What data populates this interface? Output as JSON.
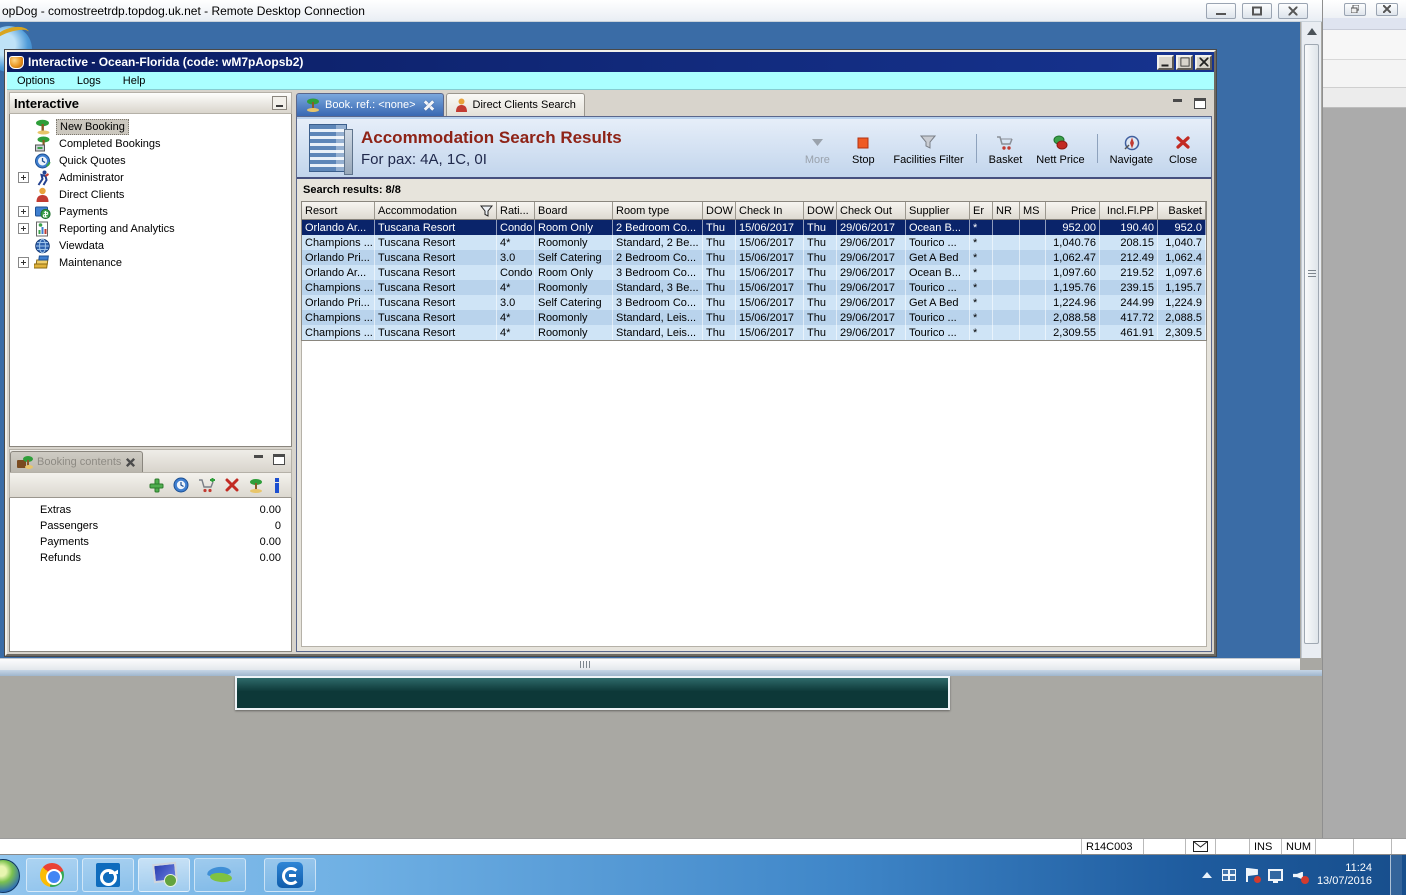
{
  "rdp": {
    "title": "opDog - comostreetrdp.topdog.uk.net - Remote Desktop Connection"
  },
  "app": {
    "title": "Interactive - Ocean-Florida (code: wM7pAopsb2)",
    "menu": {
      "options": "Options",
      "logs": "Logs",
      "help": "Help"
    }
  },
  "sidebar": {
    "title": "Interactive",
    "items": [
      {
        "label": "New Booking",
        "icon": "palm-tree-icon",
        "selected": true,
        "expandable": false
      },
      {
        "label": "Completed Bookings",
        "icon": "palm-money-icon",
        "expandable": false
      },
      {
        "label": "Quick Quotes",
        "icon": "clock-globe-icon",
        "expandable": false
      },
      {
        "label": "Administrator",
        "icon": "runner-icon",
        "expandable": true
      },
      {
        "label": "Direct Clients",
        "icon": "person-icon",
        "expandable": false
      },
      {
        "label": "Payments",
        "icon": "money-card-icon",
        "expandable": true
      },
      {
        "label": "Reporting and Analytics",
        "icon": "report-chart-icon",
        "expandable": true
      },
      {
        "label": "Viewdata",
        "icon": "globe-icon",
        "expandable": false
      },
      {
        "label": "Maintenance",
        "icon": "tools-icon",
        "expandable": true
      }
    ]
  },
  "tabs": {
    "booking": "Book. ref.: <none>",
    "direct_clients": "Direct Clients Search"
  },
  "results": {
    "title": "Accommodation Search Results",
    "subtitle": "For pax: 4A, 1C, 0I",
    "summary": "Search results: 8/8",
    "columns": [
      "Resort",
      "Accommodation",
      "Rati...",
      "Board",
      "Room type",
      "DOW",
      "Check In",
      "DOW",
      "Check Out",
      "Supplier",
      "Er",
      "NR",
      "MS",
      "Price",
      "Incl.Fl.PP",
      "Basket"
    ],
    "rows": [
      [
        "Orlando Ar...",
        "Tuscana Resort",
        "Condo",
        "Room Only",
        "2 Bedroom Co...",
        "Thu",
        "15/06/2017",
        "Thu",
        "29/06/2017",
        "Ocean B...",
        "*",
        "",
        "",
        "952.00",
        "190.40",
        "952.0"
      ],
      [
        "Champions ...",
        "Tuscana Resort",
        "4*",
        "Roomonly",
        "Standard, 2 Be...",
        "Thu",
        "15/06/2017",
        "Thu",
        "29/06/2017",
        "Tourico ...",
        "*",
        "",
        "",
        "1,040.76",
        "208.15",
        "1,040.7"
      ],
      [
        "Orlando Pri...",
        "Tuscana Resort",
        "3.0",
        "Self Catering",
        "2 Bedroom Co...",
        "Thu",
        "15/06/2017",
        "Thu",
        "29/06/2017",
        "Get A Bed",
        "*",
        "",
        "",
        "1,062.47",
        "212.49",
        "1,062.4"
      ],
      [
        "Orlando Ar...",
        "Tuscana Resort",
        "Condo",
        "Room Only",
        "3 Bedroom Co...",
        "Thu",
        "15/06/2017",
        "Thu",
        "29/06/2017",
        "Ocean B...",
        "*",
        "",
        "",
        "1,097.60",
        "219.52",
        "1,097.6"
      ],
      [
        "Champions ...",
        "Tuscana Resort",
        "4*",
        "Roomonly",
        "Standard, 3 Be...",
        "Thu",
        "15/06/2017",
        "Thu",
        "29/06/2017",
        "Tourico ...",
        "*",
        "",
        "",
        "1,195.76",
        "239.15",
        "1,195.7"
      ],
      [
        "Orlando Pri...",
        "Tuscana Resort",
        "3.0",
        "Self Catering",
        "3 Bedroom Co...",
        "Thu",
        "15/06/2017",
        "Thu",
        "29/06/2017",
        "Get A Bed",
        "*",
        "",
        "",
        "1,224.96",
        "244.99",
        "1,224.9"
      ],
      [
        "Champions ...",
        "Tuscana Resort",
        "4*",
        "Roomonly",
        "Standard, Leis...",
        "Thu",
        "15/06/2017",
        "Thu",
        "29/06/2017",
        "Tourico ...",
        "*",
        "",
        "",
        "2,088.58",
        "417.72",
        "2,088.5"
      ],
      [
        "Champions ...",
        "Tuscana Resort",
        "4*",
        "Roomonly",
        "Standard, Leis...",
        "Thu",
        "15/06/2017",
        "Thu",
        "29/06/2017",
        "Tourico ...",
        "*",
        "",
        "",
        "2,309.55",
        "461.91",
        "2,309.5"
      ]
    ],
    "selected_row": 0
  },
  "toolbar": {
    "more": "More",
    "stop": "Stop",
    "facilities_filter": "Facilities Filter",
    "basket": "Basket",
    "nett_price": "Nett Price",
    "navigate": "Navigate",
    "close": "Close"
  },
  "booking_contents": {
    "tab": "Booking contents",
    "rows": [
      {
        "label": "Extras",
        "value": "0.00"
      },
      {
        "label": "Passengers",
        "value": "0"
      },
      {
        "label": "Payments",
        "value": "0.00"
      },
      {
        "label": "Refunds",
        "value": "0.00"
      }
    ]
  },
  "status_bar": {
    "cell_ref": "R14C003",
    "ins": "INS",
    "num": "NUM"
  },
  "taskbar": {
    "time": "11:24",
    "date": "13/07/2016"
  },
  "colors": {
    "selection": "#0a246a",
    "title_red": "#8e2317",
    "rdp_background": "#3a6ca6",
    "menu_cyan": "#aaffff"
  }
}
